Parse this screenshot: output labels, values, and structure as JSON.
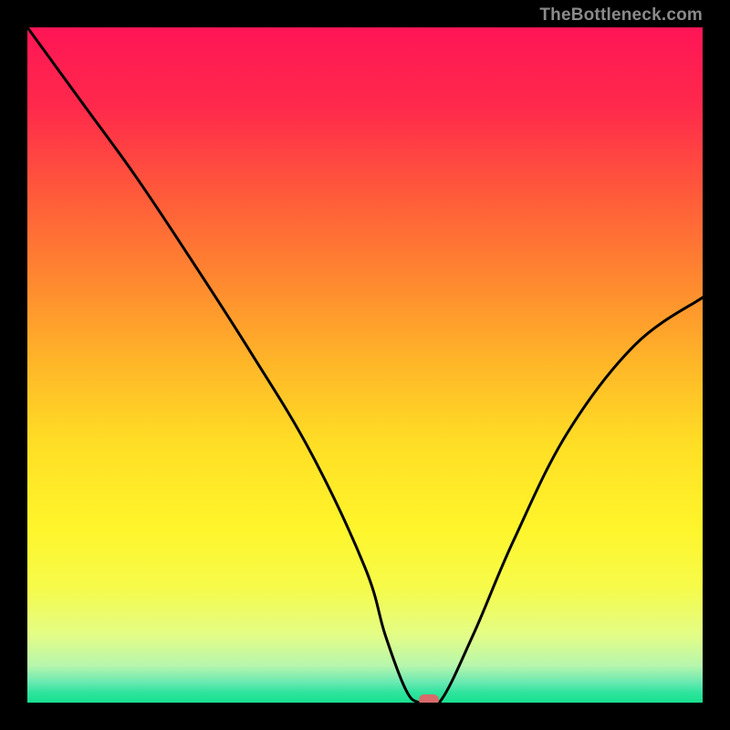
{
  "watermark": "TheBottleneck.com",
  "chart_data": {
    "type": "line",
    "title": "",
    "xlabel": "",
    "ylabel": "",
    "xlim": [
      0,
      100
    ],
    "ylim": [
      0,
      100
    ],
    "grid": false,
    "legend": false,
    "series": [
      {
        "name": "curve",
        "x": [
          0,
          8,
          16,
          24,
          33,
          42,
          50,
          53,
          56,
          58,
          61,
          66,
          72,
          80,
          90,
          100
        ],
        "y": [
          100,
          89,
          78,
          66,
          52,
          37,
          20,
          10,
          2,
          0,
          0,
          10,
          24,
          40,
          53,
          60
        ]
      }
    ],
    "marker": {
      "x": 59.5,
      "y": 0
    },
    "background_gradient": {
      "stops": [
        {
          "pos": 0.0,
          "color": "#ff1556"
        },
        {
          "pos": 0.12,
          "color": "#ff2a4b"
        },
        {
          "pos": 0.25,
          "color": "#ff5b3a"
        },
        {
          "pos": 0.38,
          "color": "#ff8a2f"
        },
        {
          "pos": 0.5,
          "color": "#ffb728"
        },
        {
          "pos": 0.62,
          "color": "#ffdf25"
        },
        {
          "pos": 0.74,
          "color": "#fff52b"
        },
        {
          "pos": 0.83,
          "color": "#f6fb4a"
        },
        {
          "pos": 0.9,
          "color": "#e3fd86"
        },
        {
          "pos": 0.945,
          "color": "#b7f6ac"
        },
        {
          "pos": 0.97,
          "color": "#69e9b2"
        },
        {
          "pos": 0.985,
          "color": "#2fe49e"
        },
        {
          "pos": 1.0,
          "color": "#18e08e"
        }
      ]
    }
  }
}
